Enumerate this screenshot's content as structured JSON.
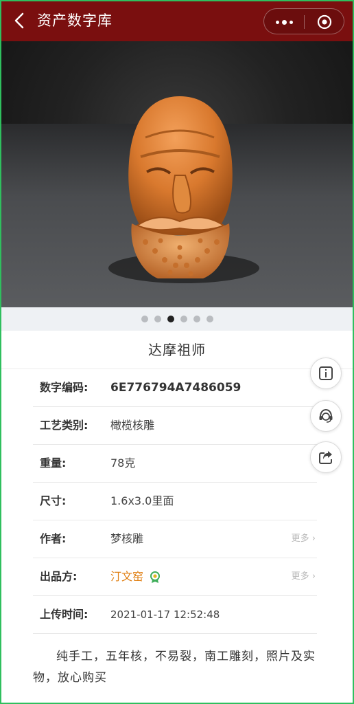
{
  "header": {
    "title": "资产数字库"
  },
  "carousel": {
    "count": 6,
    "active_index": 2
  },
  "product": {
    "name": "达摩祖师"
  },
  "details": {
    "code": {
      "label": "数字编码:",
      "value": "6E776794A7486059"
    },
    "craft": {
      "label": "工艺类别:",
      "value": "橄榄核雕"
    },
    "weight": {
      "label": "重量:",
      "value": "78克"
    },
    "size": {
      "label": "尺寸:",
      "value": "1.6x3.0里面"
    },
    "author": {
      "label": "作者:",
      "value": "梦核雕",
      "more": "更多 ›"
    },
    "producer": {
      "label": "出品方:",
      "value": "汀文窑",
      "more": "更多 ›"
    },
    "uploaded": {
      "label": "上传时间:",
      "value": "2021-01-17 12:52:48"
    }
  },
  "description": "纯手工，五年核，不易裂，南工雕刻，照片及实物，放心购买",
  "colors": {
    "header_bg": "#7a0f0f",
    "accent_orange": "#e07f12",
    "frame_green": "#2fbf5e"
  },
  "icons": [
    "back-chevron-icon",
    "more-dots-icon",
    "close-target-icon",
    "info-icon",
    "customer-service-icon",
    "share-icon",
    "certified-badge-icon"
  ]
}
